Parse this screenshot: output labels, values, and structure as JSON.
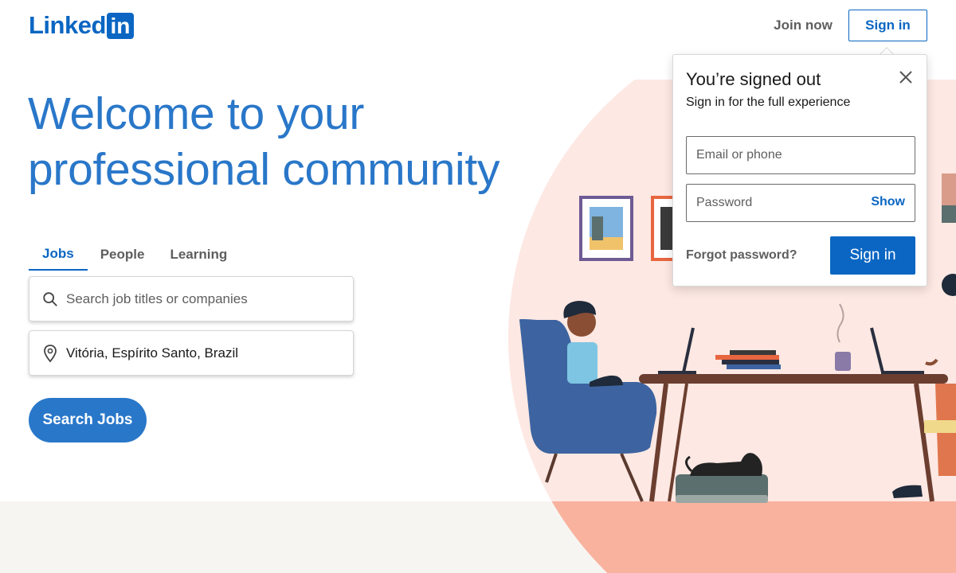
{
  "header": {
    "logo_text": "Linked",
    "logo_box_text": "in",
    "join_now": "Join now",
    "sign_in": "Sign in"
  },
  "hero": {
    "headline_line1": "Welcome to your",
    "headline_line2": "professional community"
  },
  "tabs": [
    {
      "label": "Jobs",
      "active": true
    },
    {
      "label": "People",
      "active": false
    },
    {
      "label": "Learning",
      "active": false
    }
  ],
  "search": {
    "job_placeholder": "Search job titles or companies",
    "location_value": "Vitória, Espírito Santo, Brazil",
    "button_label": "Search Jobs"
  },
  "popup": {
    "title": "You’re signed out",
    "subtitle": "Sign in for the full experience",
    "email_placeholder": "Email or phone",
    "password_placeholder": "Password",
    "show_label": "Show",
    "forgot_label": "Forgot password?",
    "signin_label": "Sign in"
  },
  "colors": {
    "brand": "#0a66c2",
    "headline": "#2977c9",
    "illustration_bg": "#fde8e3",
    "floor": "#f9b29e"
  },
  "icons": {
    "search": "search-icon",
    "location": "location-pin-icon",
    "close": "close-icon"
  }
}
